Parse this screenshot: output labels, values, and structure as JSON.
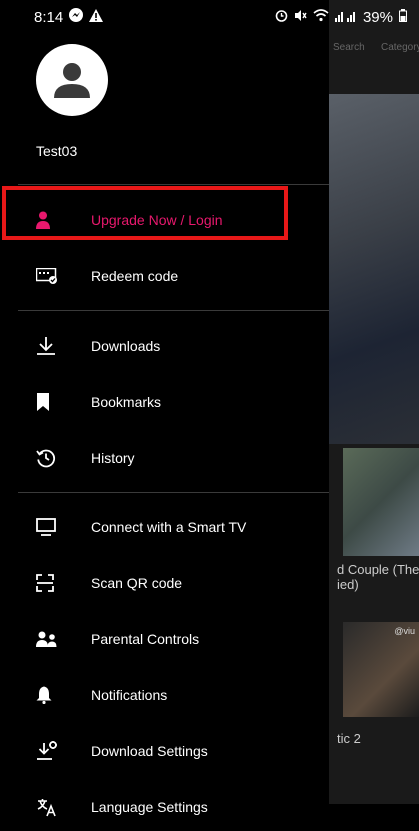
{
  "status_bar": {
    "time": "8:14",
    "battery": "39%"
  },
  "user": {
    "name": "Test03"
  },
  "menu": {
    "upgrade": "Upgrade Now / Login",
    "redeem": "Redeem code",
    "downloads": "Downloads",
    "bookmarks": "Bookmarks",
    "history": "History",
    "smart_tv": "Connect with a Smart TV",
    "scan_qr": "Scan QR code",
    "parental": "Parental Controls",
    "notifications": "Notifications",
    "download_settings": "Download Settings",
    "language": "Language Settings"
  },
  "background": {
    "search_label": "Search",
    "category_label": "Category",
    "title_1": "d Couple (The",
    "title_1b": "ied)",
    "title_2": "tic 2",
    "viu_mark": "@viu"
  },
  "colors": {
    "accent": "#e8186d",
    "highlight_box": "#e81818"
  }
}
